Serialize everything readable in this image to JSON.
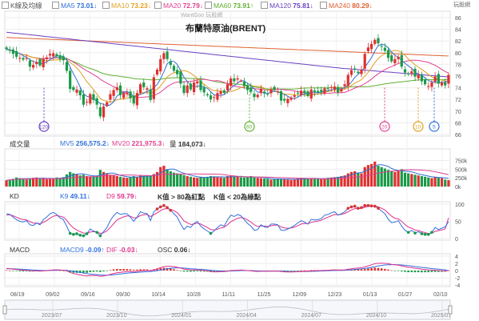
{
  "logo": "WantGoo 玩股網",
  "corner_logo": "玩股網",
  "legend": [
    {
      "label": "K線及均線",
      "color": "#555",
      "value": "",
      "arrow": ""
    },
    {
      "label": "MA5",
      "color": "#2f6fd6",
      "value": "73.01",
      "arrow": "↓"
    },
    {
      "label": "MA10",
      "color": "#e0a020",
      "value": "73.23",
      "arrow": "↓"
    },
    {
      "label": "MA20",
      "color": "#e04090",
      "value": "72.79",
      "arrow": "↓"
    },
    {
      "label": "MA60",
      "color": "#60b030",
      "value": "73.91",
      "arrow": "↑"
    },
    {
      "label": "MA120",
      "color": "#6a3fc0",
      "value": "75.81",
      "arrow": "↓"
    },
    {
      "label": "MA240",
      "color": "#e06030",
      "value": "80.29",
      "arrow": "↓"
    }
  ],
  "colors": {
    "up": "#e0302e",
    "down": "#1a9a48",
    "k": "#3070e0",
    "d": "#e0308a",
    "macd_dif": "#3070e0",
    "macd_sig": "#e0308a"
  },
  "volume_panel": {
    "title": "成交量",
    "mv5_label": "MV5",
    "mv5": "256,575.2",
    "mv5_arrow": "↓",
    "mv20_label": "MV20",
    "mv20": "221,975.3",
    "mv20_arrow": "↓",
    "vol_label": "量",
    "vol": "184,073",
    "vol_arrow": "↓"
  },
  "kd_panel": {
    "title": "KD",
    "k_label": "K9",
    "k": "49.11",
    "k_arrow": "↓",
    "d_label": "D9",
    "d": "59.79",
    "d_arrow": "↓",
    "note1": "K值 > 80為紅點",
    "note2": "K值 < 20為綠點"
  },
  "macd_panel": {
    "title": "MACD",
    "m_label": "MACD9",
    "m": "-0.09",
    "m_arrow": "↑",
    "dif_label": "DIF",
    "dif": "-0.03",
    "dif_arrow": "↓",
    "osc_label": "OSC",
    "osc": "0.06",
    "osc_arrow": "↓"
  },
  "price_markers": [
    "120",
    "60",
    "20",
    "10",
    "5"
  ],
  "chart_data": {
    "type": "candlestick",
    "title": "布蘭特原油(BRENT)",
    "price_ylim": [
      66,
      86
    ],
    "price_ticks": [
      "86",
      "84",
      "82",
      "80",
      "78",
      "76",
      "74",
      "72",
      "70",
      "68",
      "66"
    ],
    "volume_ticks": [
      "750k",
      "500k",
      "250k",
      "0k"
    ],
    "kd_ticks": [
      "100",
      "50",
      "0"
    ],
    "macd_ticks": [
      "4",
      "2",
      "0",
      "-2",
      "-4"
    ],
    "date_ticks": [
      "08/19",
      "09/02",
      "09/16",
      "09/30",
      "10/14",
      "10/28",
      "11/11",
      "11/25",
      "12/09",
      "12/23",
      "01/13",
      "01/27",
      "02/10"
    ],
    "overview_ticks": [
      "2023/07",
      "2023/10",
      "2024/01",
      "2024/04",
      "2024/07",
      "2024/10",
      "2025/01"
    ],
    "closes": [
      80.6,
      80.4,
      79.8,
      79.3,
      79.1,
      78.8,
      79.1,
      77.6,
      77.9,
      78.4,
      77.8,
      78.9,
      79.2,
      79.8,
      79.9,
      79.4,
      78.9,
      78.7,
      76.9,
      73.8,
      73.6,
      73.7,
      72.7,
      71.1,
      71.6,
      72.9,
      71.9,
      71.1,
      69.1,
      70.8,
      71.5,
      72.9,
      73.6,
      74.1,
      72.7,
      73.1,
      73.2,
      72.2,
      71.3,
      73.1,
      74.6,
      74.1,
      73.9,
      71.9,
      75.8,
      77.1,
      78.9,
      79.9,
      78.9,
      77.9,
      76.9,
      76.3,
      74.7,
      73.1,
      74.4,
      73.7,
      74.9,
      75.1,
      73.6,
      73.2,
      72.7,
      72.0,
      72.4,
      73.1,
      73.4,
      73.1,
      74.6,
      75.6,
      75.1,
      75.6,
      75.2,
      74.3,
      73.6,
      73.3,
      72.4,
      72.8,
      73.8,
      73.1,
      72.9,
      73.7,
      73.6,
      73.4,
      71.8,
      71.8,
      72.1,
      72.3,
      72.7,
      73.1,
      73.5,
      73.1,
      72.6,
      73.7,
      73.3,
      73.2,
      73.3,
      73.9,
      73.8,
      74.1,
      74.2,
      73.2,
      73.8,
      74.6,
      76.2,
      77.0,
      77.2,
      76.5,
      77.1,
      79.8,
      80.9,
      81.5,
      82.2,
      81.6,
      81.0,
      80.3,
      79.1,
      78.5,
      78.9,
      79.3,
      77.6,
      76.6,
      76.3,
      76.8,
      75.9,
      76.2,
      75.1,
      74.6,
      74.3,
      74.9,
      75.9,
      74.7,
      74.9,
      74.4,
      76.2
    ],
    "kd_k": [
      72,
      70,
      62,
      55,
      50,
      48,
      52,
      40,
      38,
      45,
      40,
      55,
      62,
      72,
      76,
      70,
      60,
      55,
      35,
      15,
      12,
      14,
      10,
      8,
      14,
      28,
      22,
      18,
      8,
      20,
      32,
      52,
      66,
      76,
      70,
      72,
      72,
      62,
      50,
      62,
      78,
      74,
      72,
      52,
      78,
      86,
      92,
      96,
      90,
      82,
      72,
      62,
      42,
      26,
      36,
      32,
      44,
      50,
      36,
      28,
      22,
      15,
      22,
      32,
      40,
      36,
      54,
      68,
      64,
      70,
      66,
      55,
      44,
      36,
      24,
      26,
      40,
      34,
      32,
      42,
      42,
      40,
      24,
      24,
      28,
      32,
      38,
      45,
      52,
      48,
      42,
      56,
      54,
      55,
      58,
      68,
      70,
      75,
      78,
      68,
      72,
      78,
      88,
      92,
      94,
      88,
      90,
      96,
      96,
      95,
      94,
      88,
      80,
      72,
      56,
      46,
      48,
      52,
      36,
      24,
      18,
      24,
      16,
      20,
      14,
      12,
      12,
      18,
      32,
      26,
      30,
      34,
      49
    ],
    "kd_d": [
      68,
      69,
      66,
      62,
      58,
      55,
      54,
      49,
      45,
      45,
      43,
      47,
      52,
      59,
      65,
      67,
      65,
      62,
      53,
      40,
      31,
      25,
      20,
      16,
      15,
      19,
      20,
      19,
      15,
      17,
      22,
      32,
      43,
      54,
      59,
      63,
      66,
      65,
      60,
      61,
      67,
      69,
      70,
      64,
      69,
      75,
      81,
      86,
      87,
      85,
      81,
      75,
      64,
      51,
      46,
      41,
      42,
      45,
      42,
      37,
      32,
      26,
      25,
      27,
      31,
      33,
      40,
      49,
      54,
      59,
      61,
      59,
      54,
      48,
      40,
      35,
      37,
      36,
      35,
      37,
      39,
      39,
      34,
      31,
      30,
      31,
      33,
      37,
      42,
      44,
      43,
      47,
      49,
      51,
      53,
      58,
      62,
      66,
      70,
      69,
      70,
      73,
      78,
      83,
      87,
      87,
      88,
      91,
      93,
      94,
      94,
      92,
      88,
      83,
      74,
      65,
      59,
      57,
      50,
      41,
      33,
      30,
      25,
      23,
      20,
      17,
      15,
      16,
      21,
      23,
      25,
      28,
      59.79
    ],
    "macd_dif": [
      0.6,
      0.5,
      0.4,
      0.3,
      0.2,
      0.1,
      0.1,
      -0.05,
      -0.1,
      -0.1,
      -0.15,
      -0.1,
      0,
      0.1,
      0.2,
      0.2,
      0.15,
      0.1,
      -0.1,
      -0.5,
      -0.8,
      -1.0,
      -1.2,
      -1.4,
      -1.5,
      -1.4,
      -1.4,
      -1.4,
      -1.6,
      -1.5,
      -1.3,
      -1.1,
      -0.8,
      -0.6,
      -0.5,
      -0.4,
      -0.3,
      -0.3,
      -0.35,
      -0.25,
      -0.1,
      0,
      0.05,
      -0.1,
      0.2,
      0.5,
      0.8,
      1.1,
      1.2,
      1.2,
      1.1,
      0.9,
      0.7,
      0.4,
      0.3,
      0.2,
      0.2,
      0.2,
      0.1,
      0,
      -0.1,
      -0.3,
      -0.35,
      -0.35,
      -0.3,
      -0.3,
      -0.15,
      0,
      0.05,
      0.1,
      0.15,
      0.1,
      0,
      -0.1,
      -0.2,
      -0.25,
      -0.2,
      -0.2,
      -0.2,
      -0.15,
      -0.15,
      -0.15,
      -0.25,
      -0.35,
      -0.4,
      -0.4,
      -0.35,
      -0.3,
      -0.25,
      -0.2,
      -0.2,
      -0.1,
      -0.05,
      -0.02,
      0,
      0.05,
      0.1,
      0.15,
      0.2,
      0.15,
      0.15,
      0.2,
      0.35,
      0.5,
      0.65,
      0.7,
      0.8,
      1.0,
      1.3,
      1.6,
      1.9,
      2.0,
      2.05,
      2.0,
      1.9,
      1.7,
      1.6,
      1.5,
      1.3,
      1.1,
      0.9,
      0.8,
      0.65,
      0.55,
      0.4,
      0.3,
      0.2,
      0.15,
      0.1,
      0,
      -0.05,
      -0.08,
      -0.03
    ],
    "macd_sig": [
      0.5,
      0.5,
      0.48,
      0.44,
      0.4,
      0.34,
      0.29,
      0.22,
      0.16,
      0.11,
      0.06,
      0.03,
      0.02,
      0.04,
      0.07,
      0.1,
      0.11,
      0.11,
      0.07,
      -0.04,
      -0.19,
      -0.35,
      -0.52,
      -0.7,
      -0.86,
      -0.97,
      -1.05,
      -1.12,
      -1.21,
      -1.27,
      -1.28,
      -1.24,
      -1.15,
      -1.04,
      -0.93,
      -0.83,
      -0.72,
      -0.64,
      -0.58,
      -0.52,
      -0.44,
      -0.35,
      -0.27,
      -0.24,
      -0.15,
      -0.02,
      0.14,
      0.33,
      0.5,
      0.64,
      0.73,
      0.76,
      0.75,
      0.68,
      0.6,
      0.52,
      0.46,
      0.41,
      0.35,
      0.28,
      0.2,
      0.1,
      0.01,
      -0.06,
      -0.11,
      -0.15,
      -0.15,
      -0.12,
      -0.09,
      -0.05,
      -0.01,
      0.01,
      0.01,
      -0.01,
      -0.05,
      -0.09,
      -0.11,
      -0.13,
      -0.14,
      -0.14,
      -0.14,
      -0.14,
      -0.16,
      -0.2,
      -0.24,
      -0.27,
      -0.29,
      -0.29,
      -0.28,
      -0.26,
      -0.25,
      -0.22,
      -0.19,
      -0.15,
      -0.12,
      -0.09,
      -0.05,
      -0.01,
      0.03,
      0.05,
      0.07,
      0.1,
      0.15,
      0.22,
      0.31,
      0.39,
      0.47,
      0.58,
      0.72,
      0.9,
      1.1,
      1.28,
      1.43,
      1.55,
      1.62,
      1.64,
      1.64,
      1.61,
      1.55,
      1.46,
      1.35,
      1.24,
      1.12,
      1.01,
      0.89,
      0.77,
      0.66,
      0.56,
      0.47,
      0.38,
      0.29,
      0.22,
      -0.09
    ],
    "volumes_k": [
      180,
      200,
      220,
      260,
      240,
      210,
      200,
      230,
      250,
      260,
      240,
      220,
      210,
      230,
      240,
      260,
      250,
      270,
      350,
      420,
      380,
      360,
      320,
      340,
      300,
      280,
      290,
      310,
      480,
      420,
      380,
      340,
      320,
      300,
      280,
      260,
      250,
      270,
      300,
      280,
      320,
      300,
      290,
      310,
      360,
      420,
      560,
      600,
      500,
      440,
      400,
      380,
      350,
      330,
      300,
      280,
      260,
      250,
      270,
      260,
      280,
      300,
      290,
      270,
      260,
      250,
      300,
      320,
      290,
      280,
      270,
      260,
      280,
      300,
      260,
      250,
      240,
      230,
      220,
      200,
      210,
      230,
      220,
      210,
      200,
      190,
      210,
      230,
      250,
      230,
      220,
      240,
      230,
      220,
      210,
      230,
      250,
      260,
      270,
      280,
      300,
      320,
      380,
      420,
      440,
      400,
      380,
      560,
      620,
      650,
      720,
      600,
      560,
      520,
      480,
      440,
      420,
      460,
      500,
      400,
      380,
      360,
      340,
      320,
      300,
      280,
      260,
      240,
      280,
      260,
      240,
      200,
      184
    ]
  }
}
